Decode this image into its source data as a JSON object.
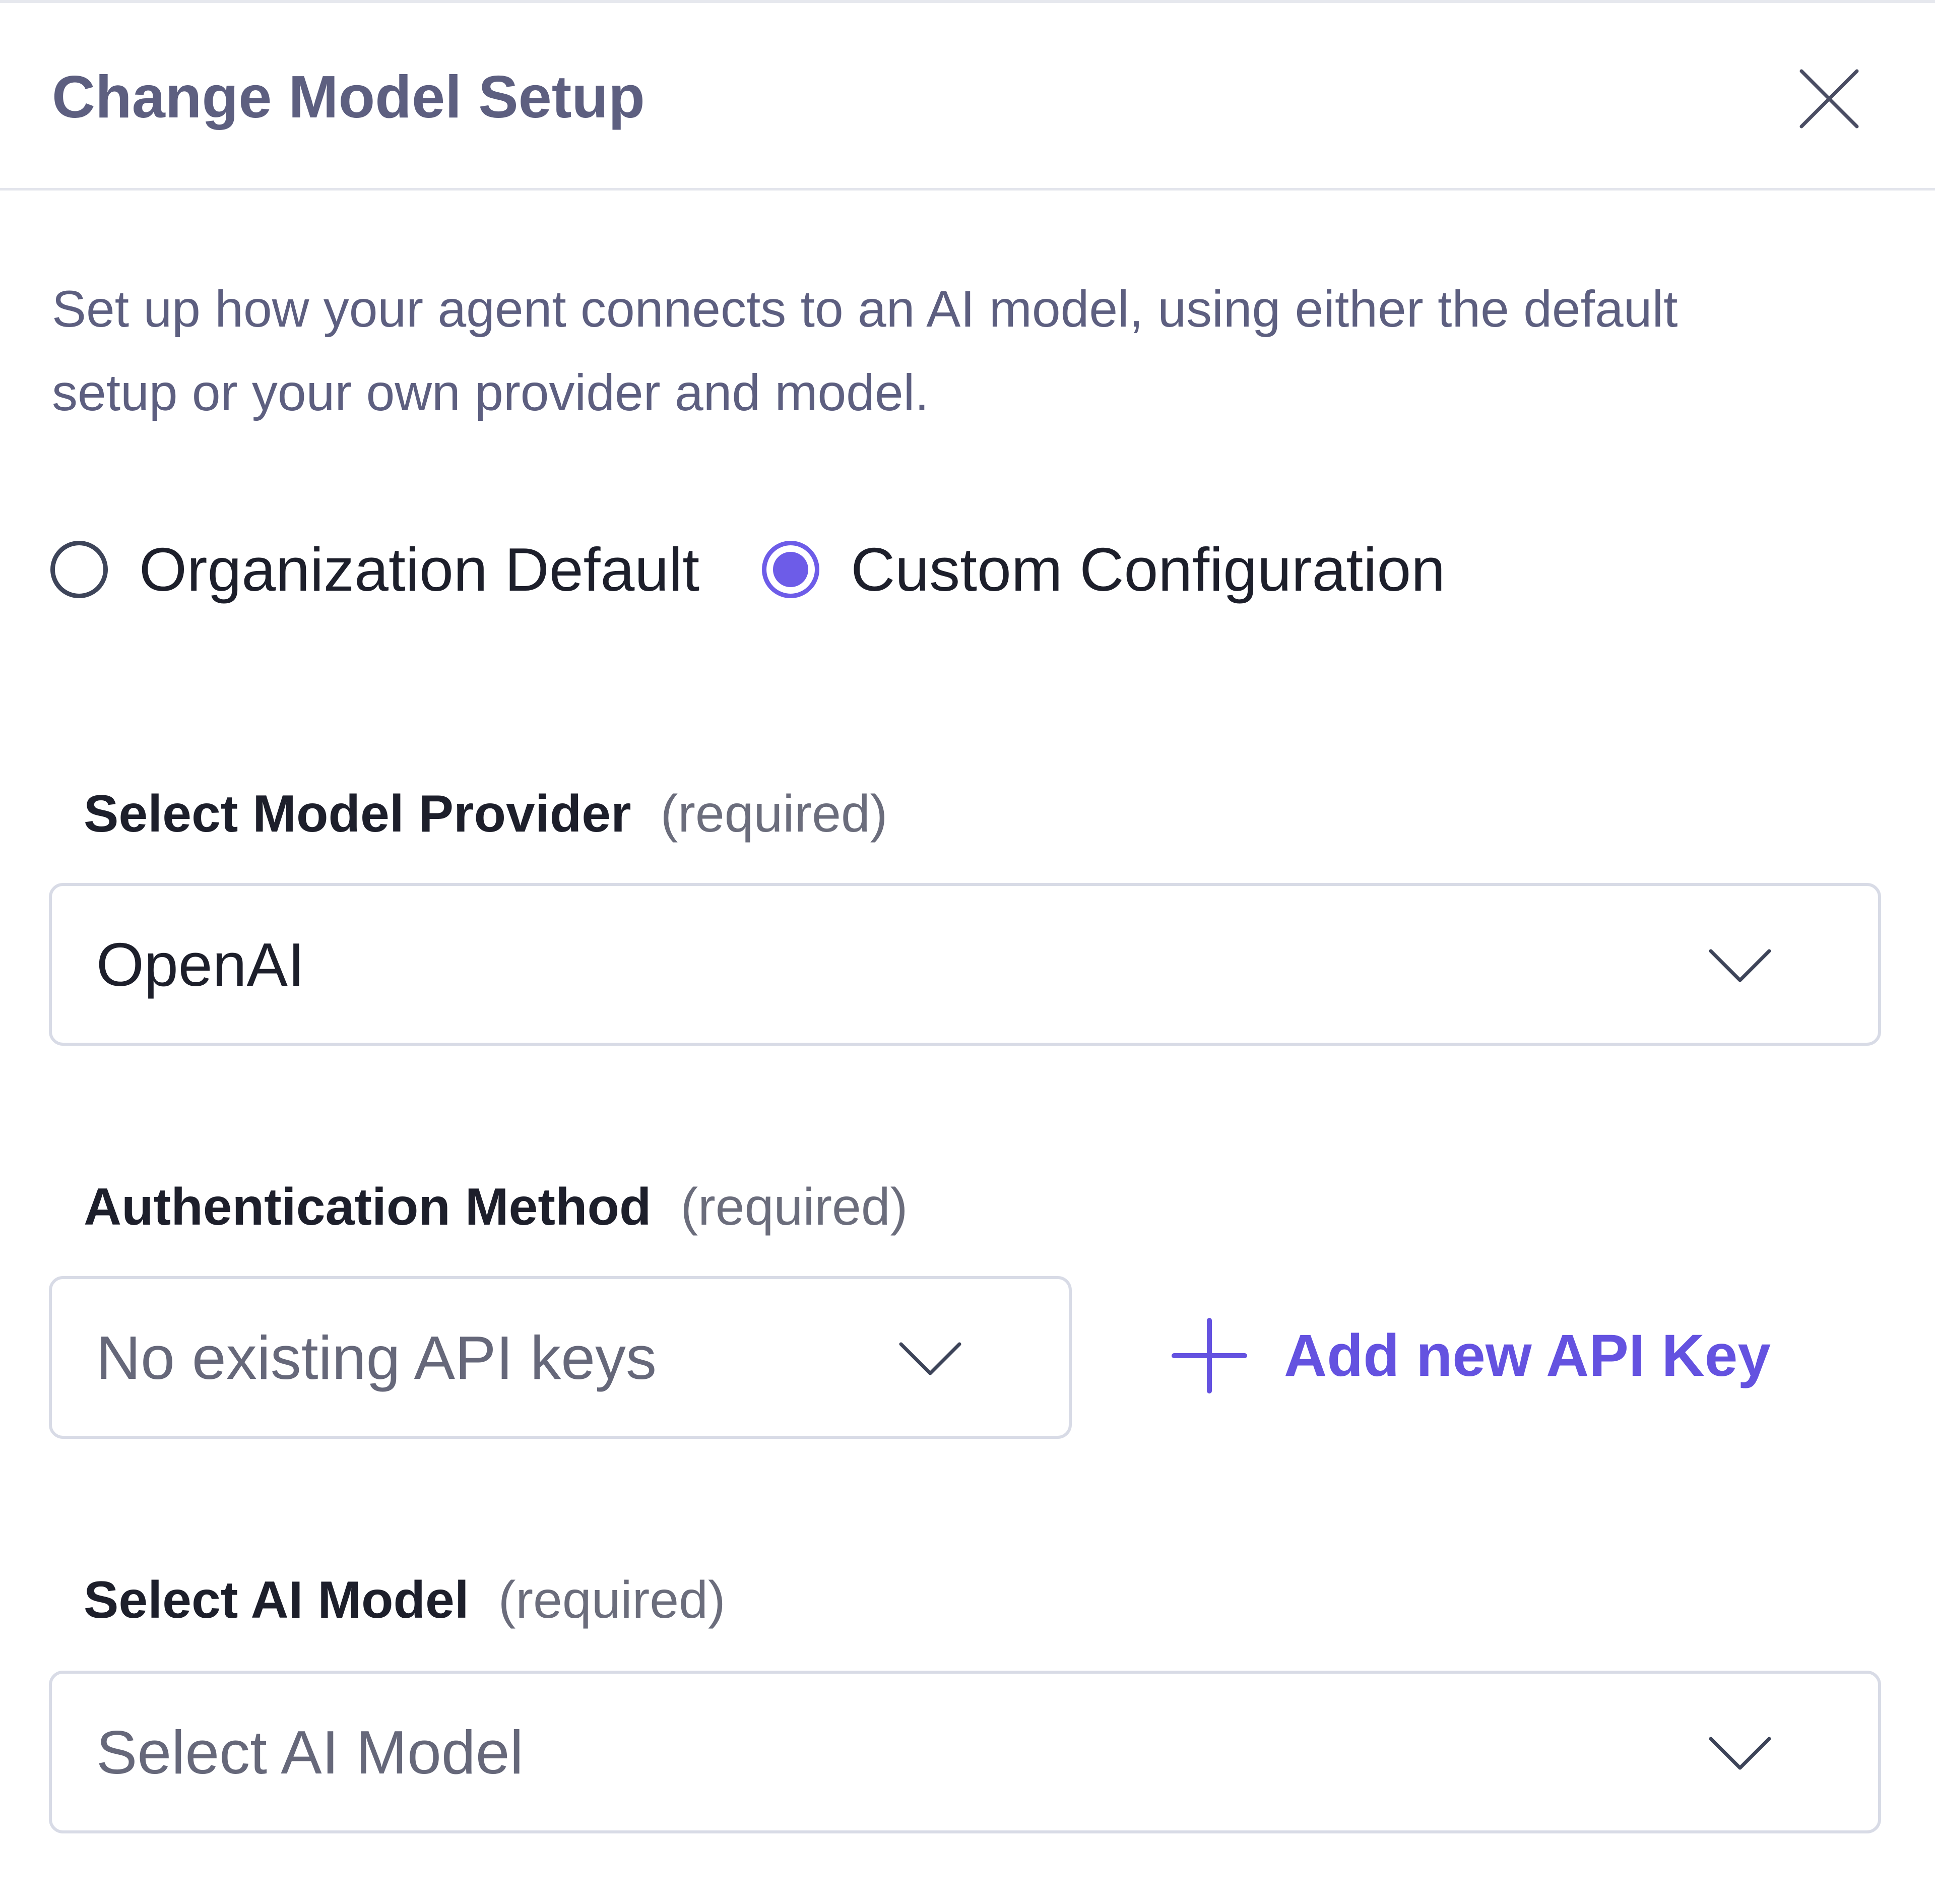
{
  "dialog": {
    "title": "Change Model Setup",
    "close_icon": "close-icon",
    "description": "Set up how your agent connects to an AI model, using either the default setup or your own provider and model."
  },
  "config_mode": {
    "options": [
      {
        "label": "Organization Default",
        "checked": false
      },
      {
        "label": "Custom Configuration",
        "checked": true
      }
    ]
  },
  "provider": {
    "label": "Select Model Provider",
    "required_text": "(required)",
    "value": "OpenAI",
    "icon": "chevron-down-icon"
  },
  "auth": {
    "label": "Authentication Method",
    "required_text": "(required)",
    "placeholder": "No existing API keys",
    "icon": "chevron-down-icon",
    "add_key_label": "Add new API Key",
    "add_key_icon": "plus-icon"
  },
  "model": {
    "label": "Select AI Model",
    "required_text": "(required)",
    "placeholder": "Select AI Model",
    "icon": "chevron-down-icon"
  },
  "colors": {
    "accent": "#6452e0",
    "title_text": "#5d5f80",
    "border": "#d8dbe6"
  }
}
